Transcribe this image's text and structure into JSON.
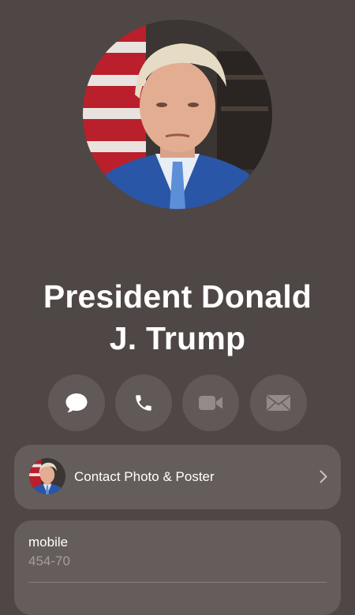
{
  "contact": {
    "name_line1": "President Donald",
    "name_line2": "J. Trump"
  },
  "actions": [
    {
      "icon": "message-icon"
    },
    {
      "icon": "phone-icon"
    },
    {
      "icon": "video-icon"
    },
    {
      "icon": "mail-icon"
    }
  ],
  "poster_card": {
    "label": "Contact Photo & Poster"
  },
  "phone": {
    "label": "mobile",
    "value": "454-70"
  },
  "colors": {
    "background": "#4f4745",
    "card": "#655d5b",
    "button": "#615957",
    "secondary_text": "#a69d9a"
  }
}
